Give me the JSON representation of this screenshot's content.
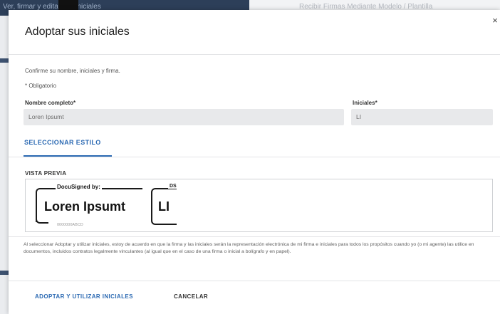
{
  "background": {
    "top_text": "Ver, firmar y editar sus iniciales",
    "right_text": "Recibir Firmas Mediante Modelo / Plantilla"
  },
  "dialog": {
    "title": "Adoptar sus iniciales",
    "close_glyph": "×",
    "intro": "Confirme su nombre, iniciales y firma.",
    "required_note": "* Obligatorio",
    "name_label": "Nombre completo*",
    "name_value": "Loren Ipsumt",
    "initials_label": "Iniciales*",
    "initials_value": "LI",
    "tab_label": "SELECCIONAR ESTILO",
    "preview_label": "VISTA PREVIA",
    "signature": {
      "header": "DocuSigned by:",
      "name": "Loren Ipsumt",
      "id": "0000000ABCD"
    },
    "initials_stamp": {
      "header": "DS",
      "text": "LI"
    },
    "disclaimer": "Al seleccionar Adoptar y utilizar iniciales, estoy de acuerdo en que la firma y las iniciales serán la representación electrónica de mi firma e iniciales para todos los propósitos cuando yo (o mi agente) las utilice en documentos, incluidos contratos legalmente vinculantes (al igual que en el caso de una firma o inicial a bolígrafo y en papel).",
    "adopt_button": "ADOPTAR Y UTILIZAR INICIALES",
    "cancel_button": "CANCELAR"
  },
  "colors": {
    "accent": "#2c6ab3",
    "field_bg": "#e8e9eb",
    "topbar": "#2d3f59"
  }
}
